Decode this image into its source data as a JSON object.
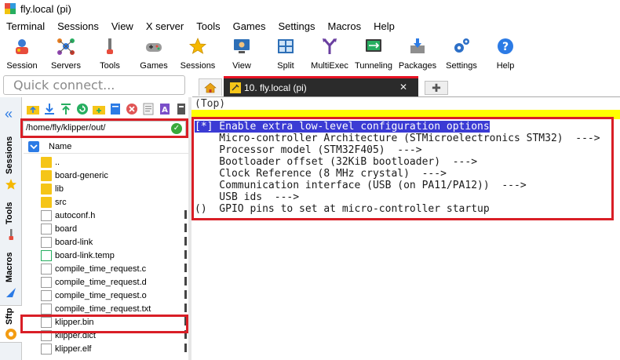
{
  "window": {
    "title": "fly.local (pi)"
  },
  "menu": [
    "Terminal",
    "Sessions",
    "View",
    "X server",
    "Tools",
    "Games",
    "Settings",
    "Macros",
    "Help"
  ],
  "toolbar": [
    {
      "label": "Session",
      "icon": "session-icon"
    },
    {
      "label": "Servers",
      "icon": "servers-icon"
    },
    {
      "label": "Tools",
      "icon": "tools-icon"
    },
    {
      "label": "Games",
      "icon": "games-icon"
    },
    {
      "label": "Sessions",
      "icon": "star-icon"
    },
    {
      "label": "View",
      "icon": "view-icon"
    },
    {
      "label": "Split",
      "icon": "split-icon"
    },
    {
      "label": "MultiExec",
      "icon": "multiexec-icon"
    },
    {
      "label": "Tunneling",
      "icon": "tunneling-icon"
    },
    {
      "label": "Packages",
      "icon": "packages-icon"
    },
    {
      "label": "Settings",
      "icon": "gear-icon"
    },
    {
      "label": "Help",
      "icon": "help-icon"
    }
  ],
  "quick_connect": {
    "placeholder": "Quick connect..."
  },
  "tabs": {
    "active_label": "10. fly.local (pi)"
  },
  "side_tabs": [
    "Sessions",
    "Tools",
    "Macros",
    "Sftp"
  ],
  "sftp": {
    "path": "/home/fly/klipper/out/",
    "column_name": "Name",
    "files": [
      {
        "name": "..",
        "type": "folder"
      },
      {
        "name": "board-generic",
        "type": "folder"
      },
      {
        "name": "lib",
        "type": "folder"
      },
      {
        "name": "src",
        "type": "folder"
      },
      {
        "name": "autoconf.h",
        "type": "file"
      },
      {
        "name": "board",
        "type": "file"
      },
      {
        "name": "board-link",
        "type": "file"
      },
      {
        "name": "board-link.temp",
        "type": "file"
      },
      {
        "name": "compile_time_request.c",
        "type": "file"
      },
      {
        "name": "compile_time_request.d",
        "type": "file"
      },
      {
        "name": "compile_time_request.o",
        "type": "file"
      },
      {
        "name": "compile_time_request.txt",
        "type": "file"
      },
      {
        "name": "klipper.bin",
        "type": "file"
      },
      {
        "name": "klipper.dict",
        "type": "file"
      },
      {
        "name": "klipper.elf",
        "type": "file"
      }
    ]
  },
  "terminal": {
    "top": "(Top)",
    "lines": [
      "[*] Enable extra low-level configuration options",
      "    Micro-controller Architecture (STMicroelectronics STM32)  --->",
      "    Processor model (STM32F405)  --->",
      "    Bootloader offset (32KiB bootloader)  --->",
      "    Clock Reference (8 MHz crystal)  --->",
      "    Communication interface (USB (on PA11/PA12))  --->",
      "    USB ids  --->",
      "()  GPIO pins to set at micro-controller startup"
    ]
  },
  "colors": {
    "highlight": "#d91e26",
    "selection": "#3b3bd4",
    "tab_accent": "#e81123"
  }
}
